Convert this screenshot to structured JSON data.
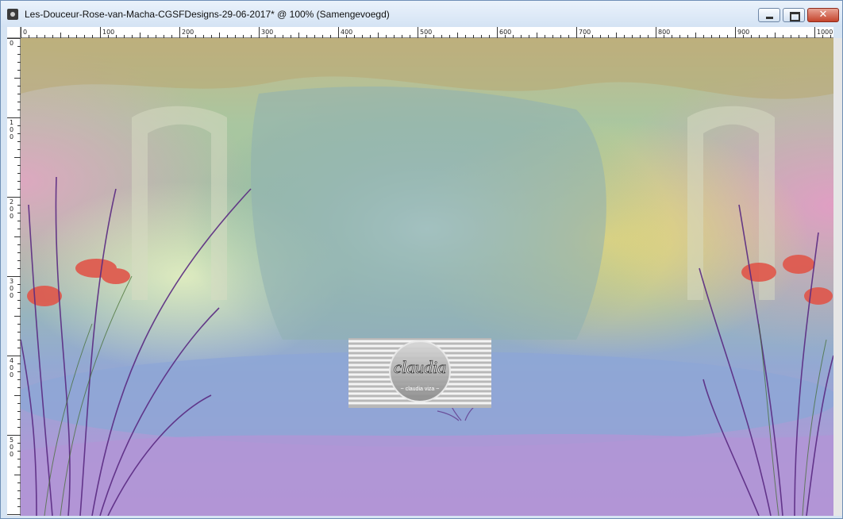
{
  "window": {
    "title": "Les-Douceur-Rose-van-Macha-CGSFDesigns-29-06-2017* @ 100% (Samengevoegd)",
    "title_font_color": "#111111",
    "titlebar_colors": [
      "#eaf2fb",
      "#d4e3f4"
    ],
    "close_glyph": "✕"
  },
  "ruler": {
    "h_labels": [
      "0",
      "100",
      "200",
      "300",
      "400",
      "500",
      "600",
      "700",
      "800",
      "900",
      "1000"
    ],
    "v_labels": [
      "0",
      "100",
      "200",
      "300",
      "400",
      "500"
    ],
    "units": "px"
  },
  "watermark": {
    "text": "claudia",
    "subtext": "~ claudia viza ~"
  },
  "icons": [
    "app-icon",
    "minimize-icon",
    "maximize-icon",
    "close-icon"
  ],
  "palette": {
    "sky_green": "#a8c9a0",
    "water_blue": "#8fa8d8",
    "lavender": "#b69ad8",
    "pink": "#e8a6c8",
    "yellow": "#e8d27a",
    "flower_red": "#e0564a",
    "grass_purple": "#5a2a82"
  }
}
